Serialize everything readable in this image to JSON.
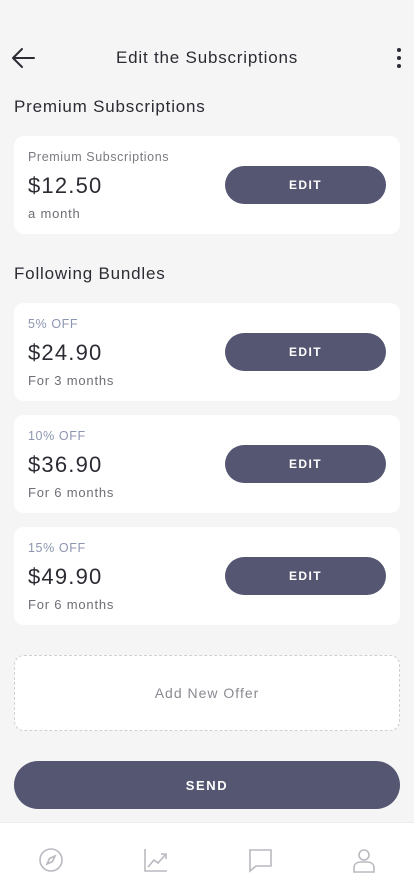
{
  "header": {
    "title": "Edit the Subscriptions",
    "back_icon": "arrow-left-icon",
    "menu_icon": "more-vertical-icon"
  },
  "premium": {
    "section_title": "Premium Subscriptions",
    "card": {
      "caption": "Premium Subscriptions",
      "price": "$12.50",
      "period": "a month",
      "button_label": "EDIT"
    }
  },
  "bundles": {
    "section_title": "Following Bundles",
    "items": [
      {
        "discount": "5% OFF",
        "price": "$24.90",
        "period": "For 3 months",
        "button_label": "EDIT"
      },
      {
        "discount": "10% OFF",
        "price": "$36.90",
        "period": "For 6 months",
        "button_label": "EDIT"
      },
      {
        "discount": "15% OFF",
        "price": "$49.90",
        "period": "For 6 months",
        "button_label": "EDIT"
      }
    ]
  },
  "add_offer_label": "Add New Offer",
  "send_label": "SEND",
  "bottom_nav": {
    "items": [
      {
        "icon": "compass-icon"
      },
      {
        "icon": "chart-icon"
      },
      {
        "icon": "chat-icon"
      },
      {
        "icon": "user-icon"
      }
    ]
  },
  "colors": {
    "accent": "#545672",
    "background": "#f5f5f6",
    "card": "#ffffff",
    "discount_text": "#8d96b0",
    "nav_icon": "#b9b9c0"
  }
}
